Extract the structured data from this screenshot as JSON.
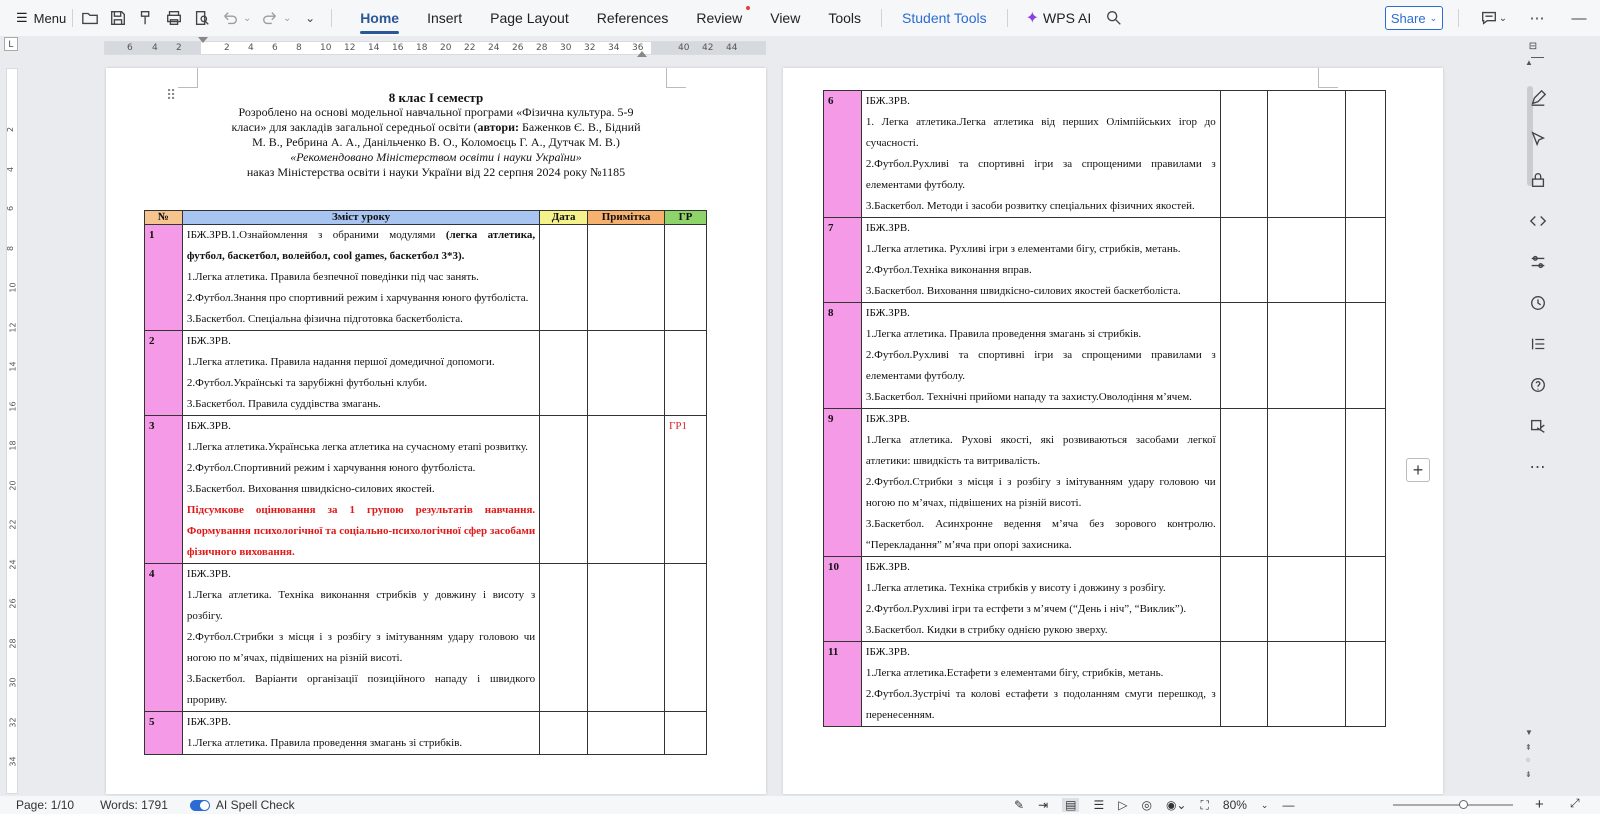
{
  "toolbar": {
    "menu_label": "Menu",
    "tabs": [
      {
        "label": "Home"
      },
      {
        "label": "Insert"
      },
      {
        "label": "Page Layout"
      },
      {
        "label": "References"
      },
      {
        "label": "Review"
      },
      {
        "label": "View"
      },
      {
        "label": "Tools"
      },
      {
        "label": "Student Tools"
      }
    ],
    "wps_ai_label": "WPS AI",
    "share_label": "Share"
  },
  "ruler": {
    "numbers": [
      "6",
      "4",
      "2",
      "2",
      "4",
      "6",
      "8",
      "10",
      "12",
      "14",
      "16",
      "18",
      "20",
      "22",
      "24",
      "26",
      "28",
      "30",
      "32",
      "34",
      "36",
      "40",
      "42",
      "44"
    ],
    "vertical_numbers": [
      "2",
      "4",
      "6",
      "8",
      "10",
      "12",
      "14",
      "16",
      "18",
      "20",
      "22",
      "24",
      "26",
      "28",
      "30",
      "32",
      "34"
    ]
  },
  "document": {
    "title": "8 клас І семестр",
    "line1": "Розроблено на основі модельної навчальної програми «Фізична культура. 5-9",
    "line2a": "класи» для закладів загальної середньої освіти (",
    "line2b": "автори:",
    "line2c": " Баженков Є. В.,  Бідний",
    "line3": "М. В., Ребрина А. А., Данільченко В. О., Коломоєць Г. А., Дутчак М. В.)",
    "line4": "«Рекомендовано Міністерством освіти і науки України»",
    "line5": "наказ Міністерства освіти і  науки України від 22 серпня 2024 року №1185",
    "headers": {
      "num": "№",
      "content": "Зміст уроку",
      "date": "Дата",
      "note": "Примітка",
      "gr": "ГР"
    },
    "rows_page1": [
      {
        "num": "1",
        "lines": [
          {
            "text": "ІБЖ.ЗРВ.1.Ознайомлення з обраними модулями ",
            "bold_tail": "(легка атлетика, футбол, баскетбол, волейбол, cool games, баскетбол 3*3)."
          },
          {
            "text": "1.Легка атлетика. Правила безпечної поведінки під час занять."
          },
          {
            "text": "2.Футбол.Знання про спортивний режим і харчування юного футболіста."
          },
          {
            "text": "3.Баскетбол. Спеціальна фізична підготовка баскетболіста."
          }
        ],
        "gr": ""
      },
      {
        "num": "2",
        "lines": [
          {
            "text": "ІБЖ.ЗРВ."
          },
          {
            "text": "1.Легка атлетика. Правила надання першої домедичної допомоги."
          },
          {
            "text": "2.Футбол.Українські та зарубіжні футбольні клуби."
          },
          {
            "text": "3.Баскетбол. Правила суддівства змагань."
          }
        ],
        "gr": ""
      },
      {
        "num": "3",
        "lines": [
          {
            "text": "ІБЖ.ЗРВ."
          },
          {
            "text": "1.Легка атлетика.Українська легка атлетика на сучасному етапі розвитку."
          },
          {
            "text": "2.Футбол.Спортивний режим і харчування юного футболіста."
          },
          {
            "text": "3.Баскетбол. Виховання швидкісно-силових якостей."
          },
          {
            "red": "Підсумкове оцінювання за 1 групою результатів навчання. Формування психологічної та соціально-психологічної сфер засобами фізичного виховання."
          }
        ],
        "gr": "ГР1"
      },
      {
        "num": "4",
        "lines": [
          {
            "text": "ІБЖ.ЗРВ."
          },
          {
            "text": "1.Легка атлетика. Техніка виконання стрибків у довжину і висоту з розбігу."
          },
          {
            "text": "2.Футбол.Стрибки з місця і з розбігу з імітуванням удару головою чи ногою по м’ячах, підвішених на різній висоті."
          },
          {
            "text": "3.Баскетбол. Варіанти організації позиційного нападу і швидкого прориву."
          }
        ],
        "gr": ""
      },
      {
        "num": "5",
        "lines": [
          {
            "text": "ІБЖ.ЗРВ."
          },
          {
            "text": "1.Легка атлетика. Правила проведення змагань зі стрибків."
          }
        ],
        "gr": ""
      }
    ],
    "rows_page2": [
      {
        "num": "6",
        "lines": [
          {
            "text": "ІБЖ.ЗРВ."
          },
          {
            "text": "1.   Легка атлетика.Легка атлетика від перших Олімпійських ігор до сучасності."
          },
          {
            "text": "2.Футбол.Рухливі та спортивні ігри за спрощеними правилами з елементами футболу."
          },
          {
            "text": "3.Баскетбол. Методи і засоби розвитку спеціальних фізичних якостей."
          }
        ]
      },
      {
        "num": "7",
        "lines": [
          {
            "text": "ІБЖ.ЗРВ."
          },
          {
            "text": "1.Легка атлетика. Рухливі ігри з елементами бігу, стрибків, метань."
          },
          {
            "text": "2.Футбол.Техніка виконання вправ."
          },
          {
            "text": "3.Баскетбол. Виховання швидкісно-силових якостей баскетболіста."
          }
        ]
      },
      {
        "num": "8",
        "lines": [
          {
            "text": "ІБЖ.ЗРВ."
          },
          {
            "text": "1.Легка атлетика. Правила проведення змагань зі стрибків."
          },
          {
            "text": "2.Футбол.Рухливі та спортивні ігри за спрощеними правилами з елементами футболу."
          },
          {
            "text": "3.Баскетбол. Технічні прийоми нападу та захисту.Оволодіння м’ячем."
          }
        ]
      },
      {
        "num": "9",
        "lines": [
          {
            "text": "ІБЖ.ЗРВ."
          },
          {
            "text": "1.Легка атлетика. Рухові якості, які розвиваються засобами легкої атлетики: швидкість та витривалість."
          },
          {
            "text": "2.Футбол.Стрибки з місця і з розбігу з імітуванням удару головою чи ногою по м’ячах, підвішених на різній висоті."
          },
          {
            "text": "3.Баскетбол. Асинхронне ведення м’яча без зорового контролю. “Перекладання” м’яча при опорі захисника."
          }
        ]
      },
      {
        "num": "10",
        "lines": [
          {
            "text": "ІБЖ.ЗРВ."
          },
          {
            "text": "1.Легка атлетика. Техніка стрибків у висоту і довжину з розбігу."
          },
          {
            "text": "2.Футбол.Рухливі ігри та естфети з м’ячем (“День і ніч”, “Виклик”)."
          },
          {
            "text": "3.Баскетбол. Кидки в стрибку однією рукою зверху."
          }
        ]
      },
      {
        "num": "11",
        "lines": [
          {
            "text": "ІБЖ.ЗРВ."
          },
          {
            "text": "1.Легка атлетика.Естафети з елементами бігу, стрибків, метань."
          },
          {
            "text": "2.Футбол.Зустрічі та колові естафети  з подоланням смуги перешкод, з перенесенням."
          }
        ]
      }
    ]
  },
  "status": {
    "page": "Page: 1/10",
    "words": "Words: 1791",
    "spell_check": "AI Spell Check",
    "zoom": "80%"
  }
}
